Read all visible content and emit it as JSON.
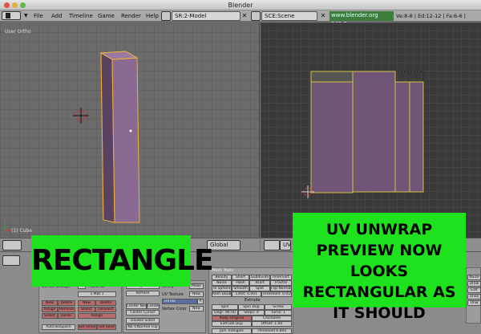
{
  "window": {
    "title": "Blender"
  },
  "menubar": {
    "items": [
      "File",
      "Add",
      "Timeline",
      "Game",
      "Render",
      "Help"
    ],
    "screen_field": "SR:2-Model",
    "scene_field": "SCE:Scene",
    "url": "www.blender.org 249.2",
    "stats": "Ve:8-8 | Ed:12-12 | Fa:6-6 |"
  },
  "viewport3d": {
    "view_label": "User Ortho",
    "object_label": "(1) Cube"
  },
  "header3d": {
    "orientation": "Global"
  },
  "uv_editor": {
    "view_menu": "UV"
  },
  "overlays": {
    "left": "RECTANGLE",
    "right": "UV UNWRAP PREVIEW NOW LOOKS RECTANGULAR AS IT SHOULD"
  },
  "buttons": {
    "link_materials": {
      "vertex_groups": "Vertex Groups",
      "material_toggle": "Material",
      "material_slot": "1 Mat 1",
      "row1": [
        "New",
        "Delete",
        "New",
        "Delete"
      ],
      "row2": [
        "Assign",
        "Remove",
        "Select",
        "Deselect"
      ],
      "row3": [
        "Select",
        "Desel.",
        "Assign"
      ],
      "autotex": "AutoTexSpace",
      "set_smooth": "Set Smooth",
      "set_solid": "Set Solid"
    },
    "mesh": {
      "degr": "Degr: 30",
      "refresh": "Refresh",
      "center_new": "Center New",
      "centre": "Center",
      "center_cursor": "Center Cursor",
      "double_sided": "Double Sided",
      "no_v_normal_flip": "No V.Normal Flip",
      "sticky": "Sticky",
      "uv_texture": "UV Texture",
      "uv_tex_value": "UVTex",
      "vertex_color": "Vertex Color",
      "make": "Make",
      "new": "New",
      "new2": "New"
    },
    "mesh_tools": {
      "title": "Mesh Tools",
      "rows": [
        [
          "Beauty",
          "Short",
          "Subdivide",
          "Innervert"
        ],
        [
          "Noise",
          "Hash",
          "Xsort",
          "Fractal"
        ],
        [
          "To Sphere",
          "Smooth",
          "Split",
          "Flip Normals"
        ],
        [
          "Rem Doubles",
          "Limit: 0.001",
          "Threshold: 0.010"
        ],
        [
          "Extrude"
        ],
        [
          "Spin",
          "Spin Dup",
          "Screw"
        ],
        [
          "Degr: 90.00",
          "Steps: 9",
          "Turns: 1"
        ],
        [
          "Keep Original",
          "Clockwise"
        ],
        [
          "Extrude Dup",
          "Offset: 1.00"
        ],
        [
          "Join Triangles",
          "Threshold 0.800"
        ]
      ]
    },
    "right_col": [
      "NSize",
      "Draw",
      "Edit",
      "Undo",
      "Unw"
    ]
  }
}
